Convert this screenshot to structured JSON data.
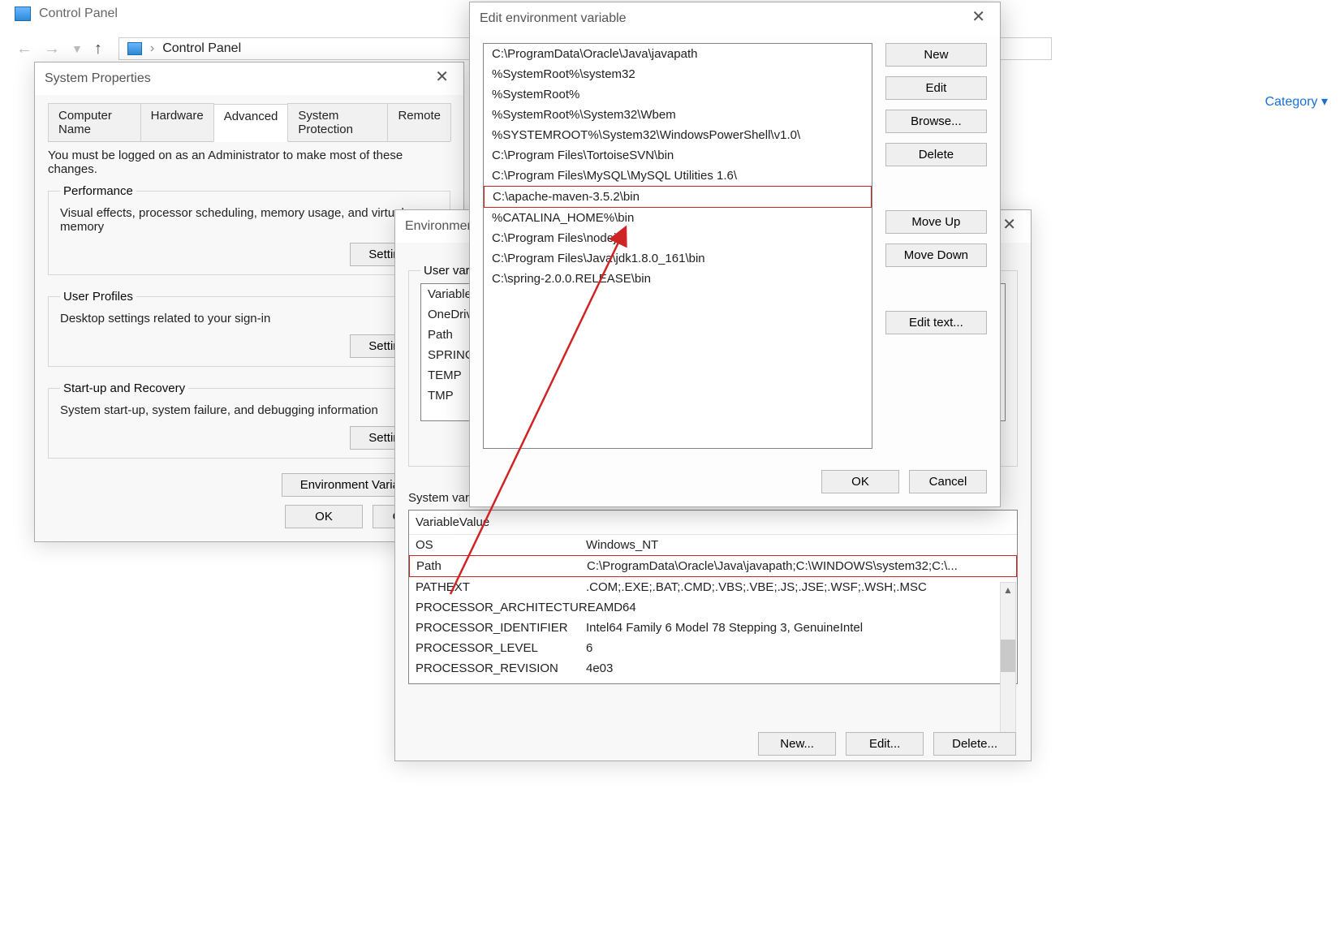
{
  "explorer": {
    "title": "Control Panel",
    "breadcrumb": "Control Panel",
    "view_by_label": "Category"
  },
  "sysprop": {
    "title": "System Properties",
    "tabs": [
      "Computer Name",
      "Hardware",
      "Advanced",
      "System Protection",
      "Remote"
    ],
    "active_tab": "Advanced",
    "admin_note": "You must be logged on as an Administrator to make most of these changes.",
    "groups": {
      "performance": {
        "legend": "Performance",
        "desc": "Visual effects, processor scheduling, memory usage, and virtual memory"
      },
      "userprofiles": {
        "legend": "User Profiles",
        "desc": "Desktop settings related to your sign-in"
      },
      "startup": {
        "legend": "Start-up and Recovery",
        "desc": "System start-up, system failure, and debugging information"
      }
    },
    "buttons": {
      "settings": "Settings...",
      "envvars": "Environment Variables...",
      "ok": "OK",
      "cancel": "Cancel"
    }
  },
  "envvars": {
    "title": "Environment Variables",
    "user_section": "User variables",
    "user_vars": [
      "Variable",
      "OneDrive",
      "Path",
      "SPRING",
      "TEMP",
      "TMP"
    ],
    "sys_section": "System variables",
    "headers": {
      "var": "Variable",
      "val": "Value"
    },
    "sys_rows": [
      {
        "var": "OS",
        "val": "Windows_NT"
      },
      {
        "var": "Path",
        "val": "C:\\ProgramData\\Oracle\\Java\\javapath;C:\\WINDOWS\\system32;C:\\..."
      },
      {
        "var": "PATHEXT",
        "val": ".COM;.EXE;.BAT;.CMD;.VBS;.VBE;.JS;.JSE;.WSF;.WSH;.MSC"
      },
      {
        "var": "PROCESSOR_ARCHITECTURE",
        "val": "AMD64"
      },
      {
        "var": "PROCESSOR_IDENTIFIER",
        "val": "Intel64 Family 6 Model 78 Stepping 3, GenuineIntel"
      },
      {
        "var": "PROCESSOR_LEVEL",
        "val": "6"
      },
      {
        "var": "PROCESSOR_REVISION",
        "val": "4e03"
      }
    ],
    "highlight_sys_row": "Path",
    "buttons": {
      "new": "New...",
      "edit": "Edit...",
      "delete": "Delete..."
    }
  },
  "editpath": {
    "title": "Edit environment variable",
    "entries": [
      "C:\\ProgramData\\Oracle\\Java\\javapath",
      "%SystemRoot%\\system32",
      "%SystemRoot%",
      "%SystemRoot%\\System32\\Wbem",
      "%SYSTEMROOT%\\System32\\WindowsPowerShell\\v1.0\\",
      "C:\\Program Files\\TortoiseSVN\\bin",
      "C:\\Program Files\\MySQL\\MySQL Utilities 1.6\\",
      "C:\\apache-maven-3.5.2\\bin",
      "%CATALINA_HOME%\\bin",
      "C:\\Program Files\\nodejs\\",
      "C:\\Program Files\\Java\\jdk1.8.0_161\\bin",
      "C:\\spring-2.0.0.RELEASE\\bin"
    ],
    "highlight_entry": "C:\\apache-maven-3.5.2\\bin",
    "buttons": {
      "new": "New",
      "edit": "Edit",
      "browse": "Browse...",
      "delete": "Delete",
      "moveup": "Move Up",
      "movedown": "Move Down",
      "edittext": "Edit text...",
      "ok": "OK",
      "cancel": "Cancel"
    }
  }
}
